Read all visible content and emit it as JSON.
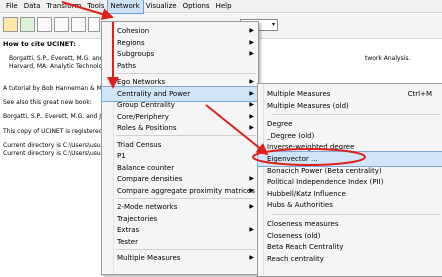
{
  "menubar": [
    "File",
    "Data",
    "Transform",
    "Tools",
    "Network",
    "Visualize",
    "Options",
    "Help"
  ],
  "active_menu_index": 4,
  "content": {
    "cite_heading": "How to cite UCINET:",
    "cite_line1": "Borgatti, S.P., Everett, M.G. and Fre",
    "cite_line1_tail": "twork Analysis.",
    "cite_line2": "Harvard, MA: Analytic Technologie",
    "tutorial": "A tutorial by Bob Hanneman & Mark R",
    "see_also": "See also this great new book:",
    "book": "Borgatti, S.P., Everett, M.G. and Jol",
    "copy": "This copy of UCINET is registered to (",
    "dir1": "Current directory is C:\\Users\\usuario\\",
    "dir2": "Current directory is C:\\Users\\usuario\\"
  },
  "network_menu": [
    {
      "label": "Cohesion",
      "sub": true
    },
    {
      "label": "Regions",
      "sub": true
    },
    {
      "label": "Subgroups",
      "sub": true
    },
    {
      "label": "Paths",
      "sub": false
    },
    {
      "sep": true
    },
    {
      "label": "Ego Networks",
      "sub": true
    },
    {
      "label": "Centrality and Power",
      "sub": true,
      "hl": true
    },
    {
      "label": "Group Centrality",
      "sub": true
    },
    {
      "label": "Core/Periphery",
      "sub": true
    },
    {
      "label": "Roles & Positions",
      "sub": true
    },
    {
      "sep": true
    },
    {
      "label": "Triad Census",
      "sub": false
    },
    {
      "label": "P1",
      "sub": false
    },
    {
      "label": "Balance counter",
      "sub": false
    },
    {
      "label": "Compare densities",
      "sub": true
    },
    {
      "label": "Compare aggregate proximity matrices",
      "sub": true
    },
    {
      "sep": true
    },
    {
      "label": "2-Mode networks",
      "sub": true
    },
    {
      "label": "Trajectories",
      "sub": false
    },
    {
      "label": "Extras",
      "sub": true
    },
    {
      "label": "Tester",
      "sub": false
    },
    {
      "sep": true
    },
    {
      "label": "Multiple Measures",
      "sub": true
    }
  ],
  "centrality_menu": [
    {
      "label": "Multiple Measures",
      "shortcut": "Ctrl+M"
    },
    {
      "label": "Multiple Measures (old)"
    },
    {
      "sep": true
    },
    {
      "label": "Degree"
    },
    {
      "label": "_Degree (old)"
    },
    {
      "label": "Inverse-weighted degree"
    },
    {
      "label": "Eigenvector ...",
      "hl": true
    },
    {
      "label": "Bonacich Power (Beta centrality)"
    },
    {
      "label": "Political Independence Index (PII)"
    },
    {
      "label": "Hubbell/Katz Influence"
    },
    {
      "label": "Hubs & Authorities"
    },
    {
      "sep": true
    },
    {
      "label": "Closeness measures"
    },
    {
      "label": "Closeness (old)"
    },
    {
      "label": "Beta Reach Centrality"
    },
    {
      "label": "Reach centrality"
    }
  ],
  "annotation_color": "#e0201b"
}
